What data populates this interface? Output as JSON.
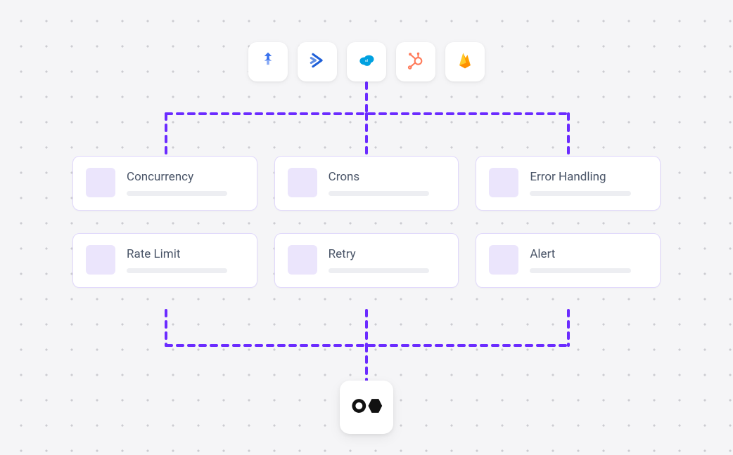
{
  "colors": {
    "connector": "#6b2bff",
    "card_border": "#e0d8fb",
    "chip_bg": "#ebe5fc",
    "bar_bg": "#edeef2",
    "text": "#4a5568",
    "bg": "#f5f5f7"
  },
  "integrations": [
    {
      "name": "jira",
      "color": "#2563eb"
    },
    {
      "name": "activecampaign",
      "color": "#1e5fd8"
    },
    {
      "name": "salesforce",
      "color": "#00a1e0"
    },
    {
      "name": "hubspot",
      "color": "#ff7a59"
    },
    {
      "name": "firebase",
      "color": "#ffa000"
    }
  ],
  "features": [
    {
      "label": "Concurrency"
    },
    {
      "label": "Crons"
    },
    {
      "label": "Error Handling"
    },
    {
      "label": "Rate Limit"
    },
    {
      "label": "Retry"
    },
    {
      "label": "Alert"
    }
  ],
  "bottom_logo": "target-brand"
}
